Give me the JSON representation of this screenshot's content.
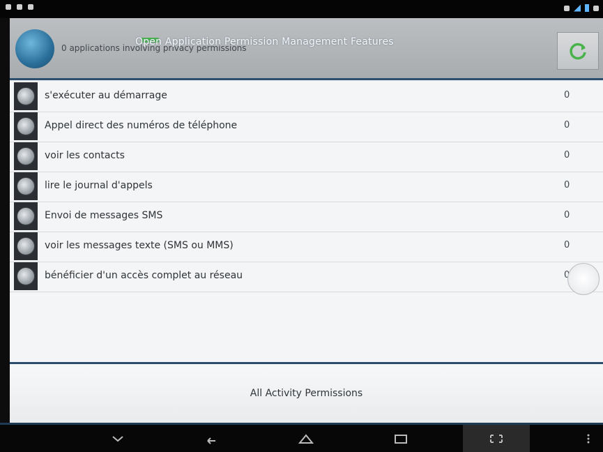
{
  "header": {
    "title": "Open Application Permission Management Features",
    "subtitle": "0 applications involving privacy permissions"
  },
  "permissions": [
    {
      "label": "s'exécuter au démarrage",
      "count": "0"
    },
    {
      "label": "Appel direct des numéros de téléphone",
      "count": "0"
    },
    {
      "label": "voir les contacts",
      "count": "0"
    },
    {
      "label": "lire le journal d'appels",
      "count": "0"
    },
    {
      "label": "Envoi de messages SMS",
      "count": "0"
    },
    {
      "label": "voir les messages texte (SMS ou MMS)",
      "count": "0"
    },
    {
      "label": "bénéficier d'un accès complet au réseau",
      "count": "0"
    }
  ],
  "footer": {
    "button_label": "All Activity Permissions"
  },
  "colors": {
    "accent": "#2d4f6f",
    "green": "#47b34a",
    "status_blue": "#5fb5ff"
  },
  "icons": {
    "refresh": "refresh-icon",
    "globe": "globe-icon",
    "nav": [
      "keyboard-hide-icon",
      "back-icon",
      "home-icon",
      "recents-icon",
      "screenshot-icon",
      "menu-icon"
    ]
  }
}
